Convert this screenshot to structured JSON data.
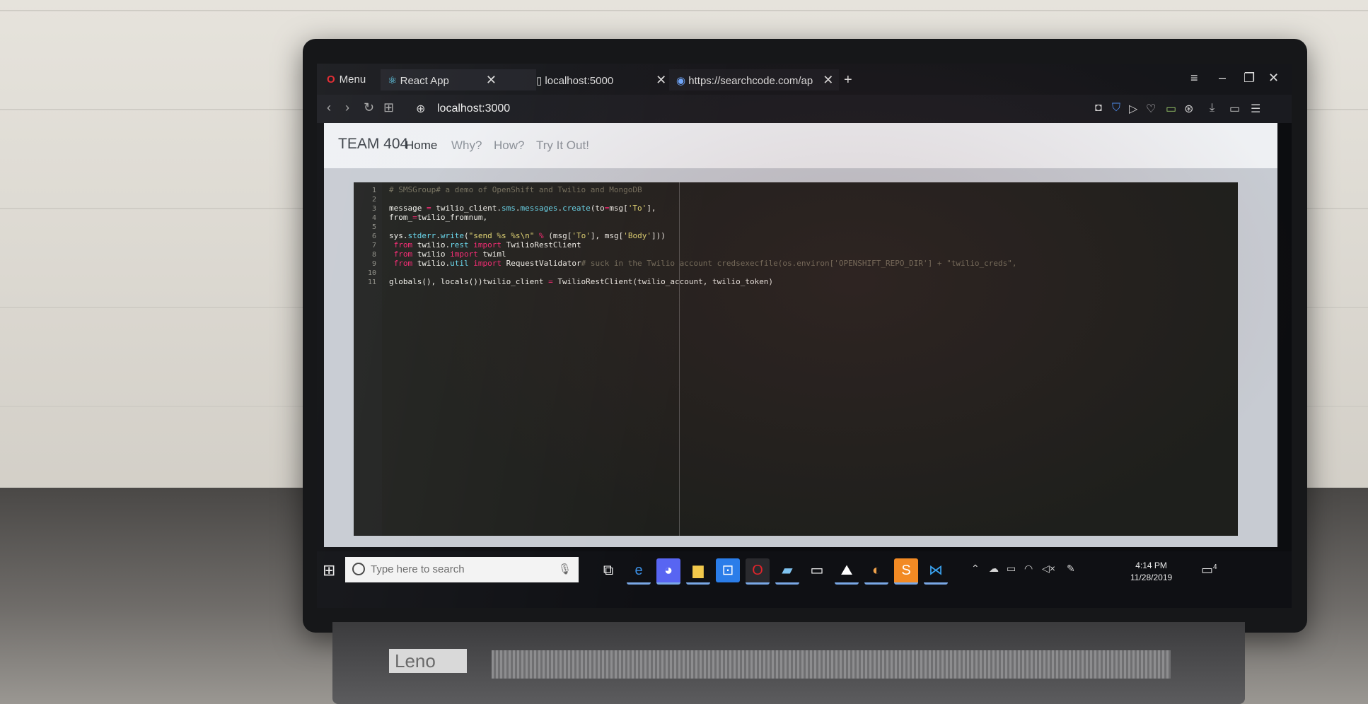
{
  "browser": {
    "menu_label": "Menu",
    "tabs": [
      {
        "title": "React App"
      },
      {
        "title": "localhost:5000"
      },
      {
        "title": "https://searchcode.com/ap"
      }
    ],
    "url": "localhost:3000"
  },
  "page": {
    "brand": "TEAM 404",
    "nav": [
      "Home",
      "Why?",
      "How?",
      "Try It Out!"
    ]
  },
  "editor": {
    "line_numbers": [
      "1",
      "2",
      "3",
      "4",
      "5",
      "6",
      "7",
      "8",
      "9",
      "10",
      "11"
    ]
  },
  "taskbar": {
    "search_placeholder": "Type here to search",
    "time": "4:14 PM",
    "date": "11/28/2019",
    "notification_count": "4"
  },
  "laptop": {
    "brand_text": "Leno"
  },
  "icons": {
    "back": "back-arrow-icon",
    "forward": "forward-arrow-icon",
    "reload": "reload-icon",
    "tabs_grid": "grid-icon",
    "globe": "globe-icon",
    "windows": "windows-start-icon",
    "mic": "microphone-icon"
  }
}
